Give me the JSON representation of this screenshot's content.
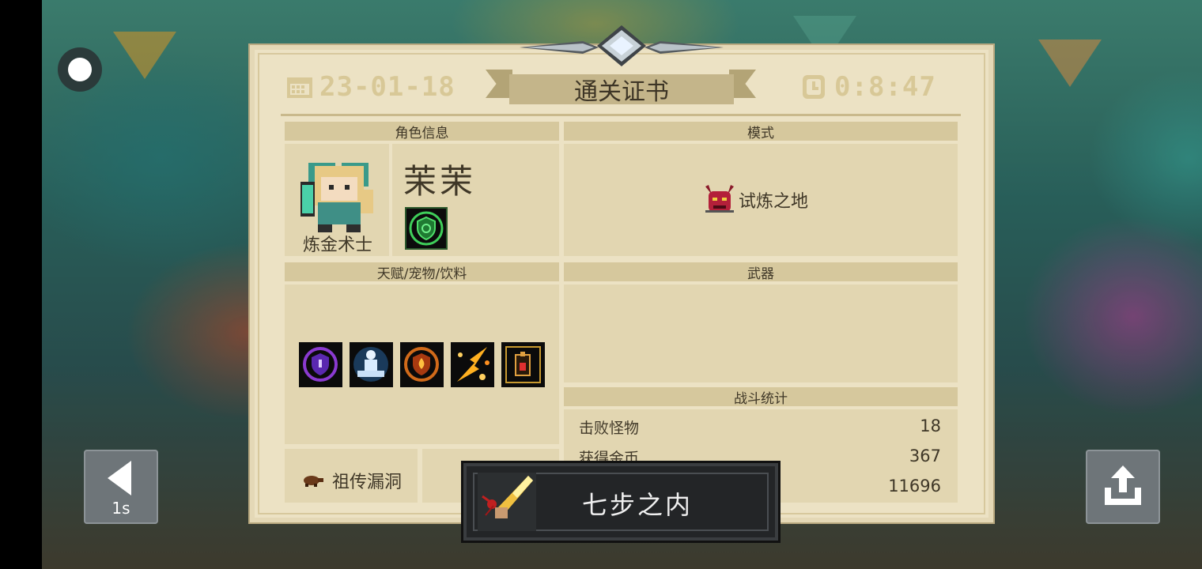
{
  "certificate": {
    "title": "通关证书",
    "date": "23-01-18",
    "time": "0:8:47"
  },
  "sections": {
    "character_info": "角色信息",
    "mode": "模式",
    "talents_pets_drinks": "天赋/宠物/饮料",
    "weapon": "武器",
    "combat_stats": "战斗统计"
  },
  "character": {
    "name": "茉茉",
    "class": "炼金术士"
  },
  "mode": {
    "name": "试炼之地"
  },
  "stats": [
    {
      "label": "击败怪物",
      "value": "18"
    },
    {
      "label": "获得金币",
      "value": "367"
    },
    {
      "label": "",
      "value": "11696"
    }
  ],
  "pet": {
    "label": "祖传漏洞"
  },
  "toast": {
    "text": "七步之内"
  },
  "controls": {
    "back_count": "1s"
  },
  "icons": {
    "record": "record-icon",
    "back": "back-arrow-icon",
    "share": "share-icon",
    "calendar": "calendar-icon",
    "clock": "clock-icon"
  }
}
